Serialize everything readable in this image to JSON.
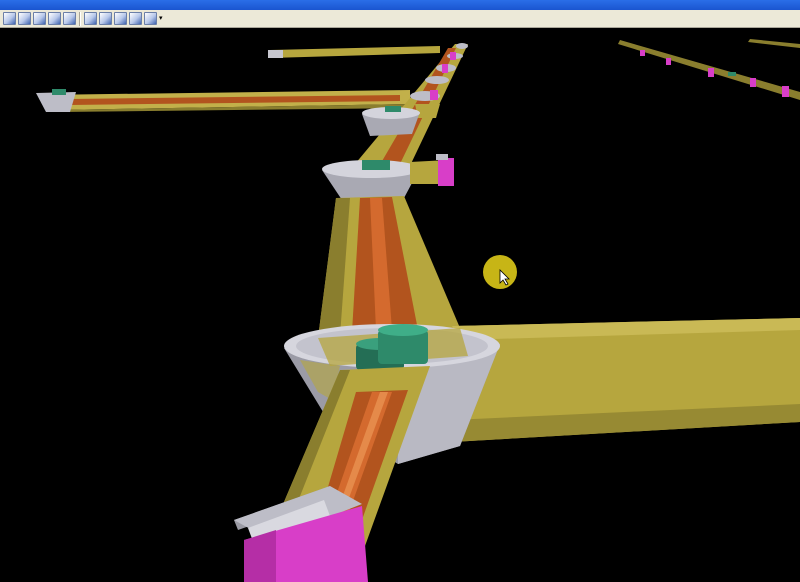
{
  "toolbar": {
    "buttons": [
      {
        "icon": "view-front-icon"
      },
      {
        "icon": "view-back-icon"
      },
      {
        "icon": "view-left-icon"
      },
      {
        "icon": "view-right-icon"
      },
      {
        "icon": "view-top-icon"
      },
      {
        "icon": "view-iso-1-icon"
      },
      {
        "icon": "view-iso-2-icon"
      },
      {
        "icon": "view-iso-3-icon"
      },
      {
        "icon": "print-icon"
      },
      {
        "icon": "layers-icon"
      }
    ]
  },
  "colors": {
    "background": "#000000",
    "tunnel": "#b6a63e",
    "pipe": "#b2541e",
    "chamber": "#b9b9c3",
    "equipment": "#2e8a6a",
    "gate": "#d83ec8",
    "cursor_highlight": "#d8c418"
  }
}
